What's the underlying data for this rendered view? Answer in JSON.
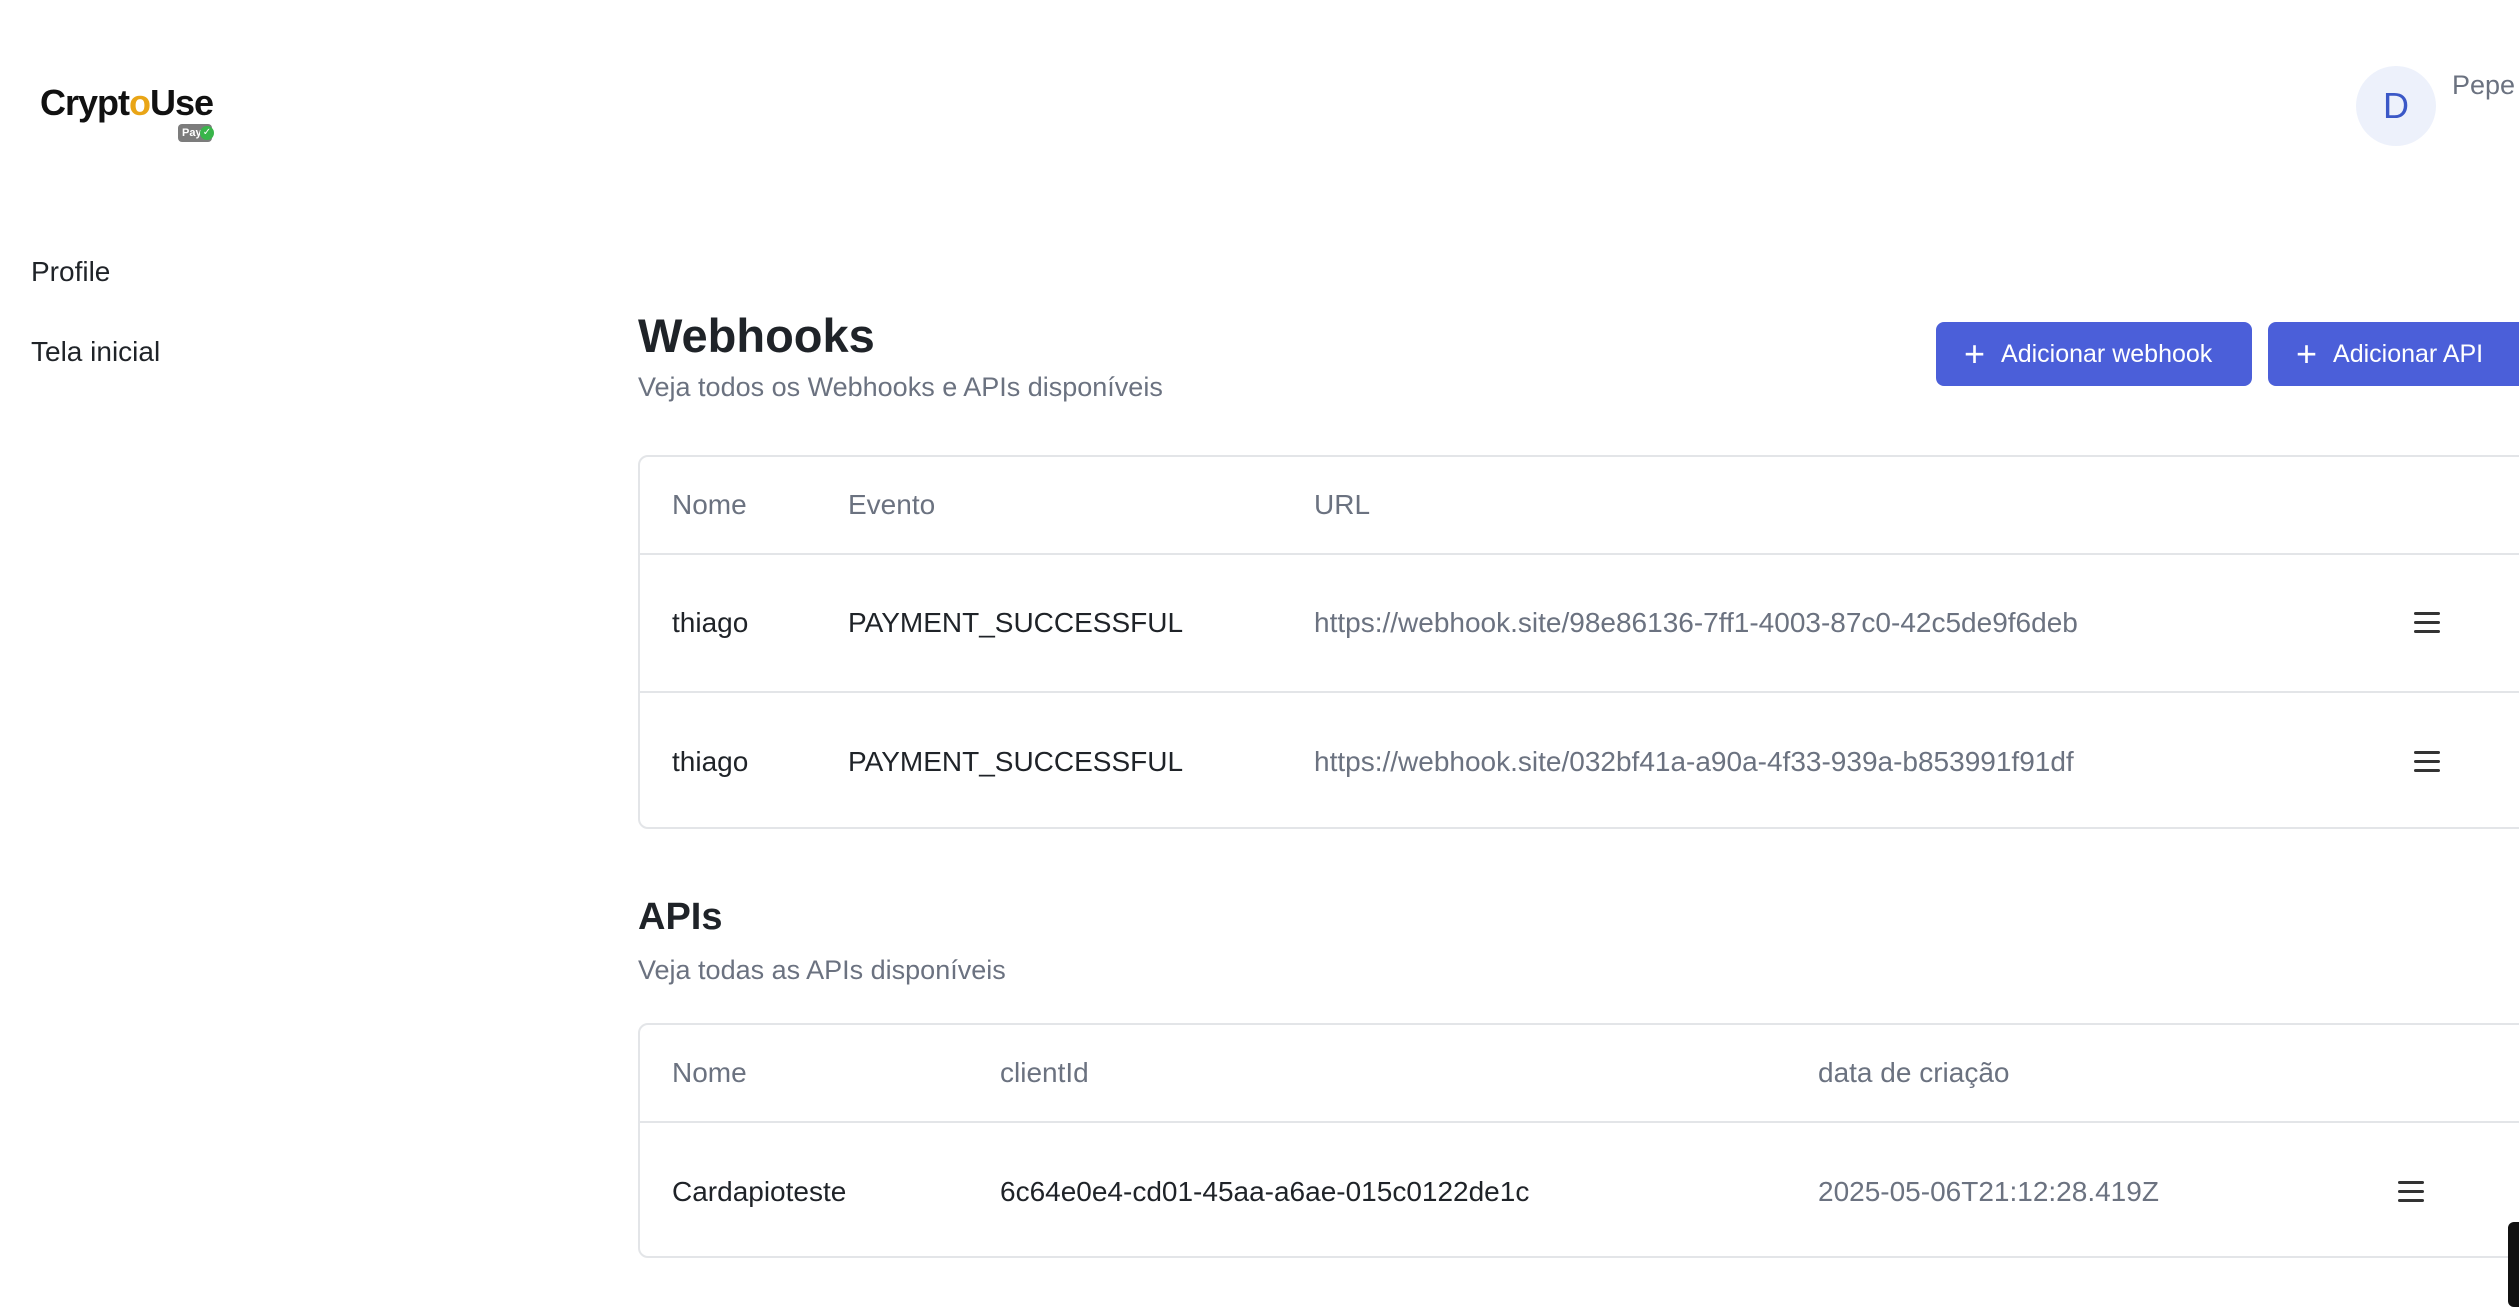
{
  "brand": {
    "name_part1": "Crypt",
    "name_o": "o",
    "name_part2": "Use",
    "badge": "Pay",
    "badge_check": "✓"
  },
  "header": {
    "avatar_initial": "D",
    "username": "Pepe"
  },
  "sidebar": {
    "items": [
      {
        "label": "Profile"
      },
      {
        "label": "Tela inicial"
      }
    ]
  },
  "webhooks": {
    "title": "Webhooks",
    "subtitle": "Veja todos os Webhooks e APIs disponíveis",
    "add_webhook_label": "Adicionar webhook",
    "add_api_label": "Adicionar API",
    "columns": [
      "Nome",
      "Evento",
      "URL"
    ],
    "rows": [
      {
        "name": "thiago",
        "event": "PAYMENT_SUCCESSFUL",
        "url": "https://webhook.site/98e86136-7ff1-4003-87c0-42c5de9f6deb"
      },
      {
        "name": "thiago",
        "event": "PAYMENT_SUCCESSFUL",
        "url": "https://webhook.site/032bf41a-a90a-4f33-939a-b853991f91df"
      }
    ]
  },
  "apis": {
    "title": "APIs",
    "subtitle": "Veja todas as APIs disponíveis",
    "columns": [
      "Nome",
      "clientId",
      "data de criação"
    ],
    "rows": [
      {
        "name": "Cardapioteste",
        "client_id": "6c64e0e4-cd01-45aa-a6ae-015c0122de1c",
        "created_at": "2025-05-06T21:12:28.419Z"
      }
    ]
  },
  "colors": {
    "accent": "#4b5fd9",
    "avatar_bg": "#edf1fb",
    "border": "#e3e5e8",
    "muted_text": "#6b7280"
  }
}
